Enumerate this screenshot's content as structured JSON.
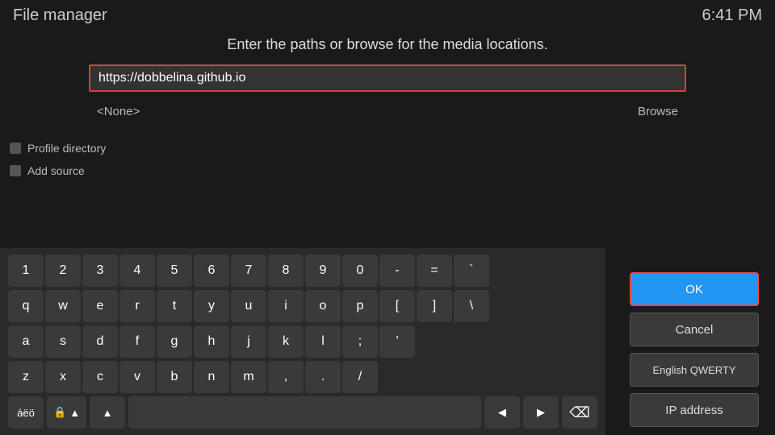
{
  "header": {
    "title": "File manager",
    "clock": "6:41 PM"
  },
  "dialog": {
    "prompt": "Enter the paths or browse for the media locations.",
    "url_value": "https://dobbelina.github.io",
    "path_left": "<None>",
    "path_right": "Browse"
  },
  "sidebar": {
    "items": [
      {
        "label": "Profile directory"
      },
      {
        "label": "Add source"
      }
    ]
  },
  "keyboard": {
    "row1": [
      "1",
      "2",
      "3",
      "4",
      "5",
      "6",
      "7",
      "8",
      "9",
      "0",
      "-",
      "=",
      "`"
    ],
    "row2": [
      "q",
      "w",
      "e",
      "r",
      "t",
      "y",
      "u",
      "i",
      "o",
      "p",
      "[",
      "]",
      "\\"
    ],
    "row3": [
      "a",
      "s",
      "d",
      "f",
      "g",
      "h",
      "j",
      "k",
      "l",
      ";",
      "'"
    ],
    "row4": [
      "z",
      "x",
      "c",
      "v",
      "b",
      "n",
      "m",
      ",",
      ".",
      "/"
    ],
    "bottom": {
      "special_chars_label": "áëö",
      "caps_label": "⇧",
      "shift_label": "▲",
      "arrow_left": "◀",
      "arrow_right": "▶",
      "backspace": "⌫"
    }
  },
  "right_panel": {
    "ok_label": "OK",
    "cancel_label": "Cancel",
    "layout_label": "English QWERTY",
    "ip_label": "IP address"
  }
}
